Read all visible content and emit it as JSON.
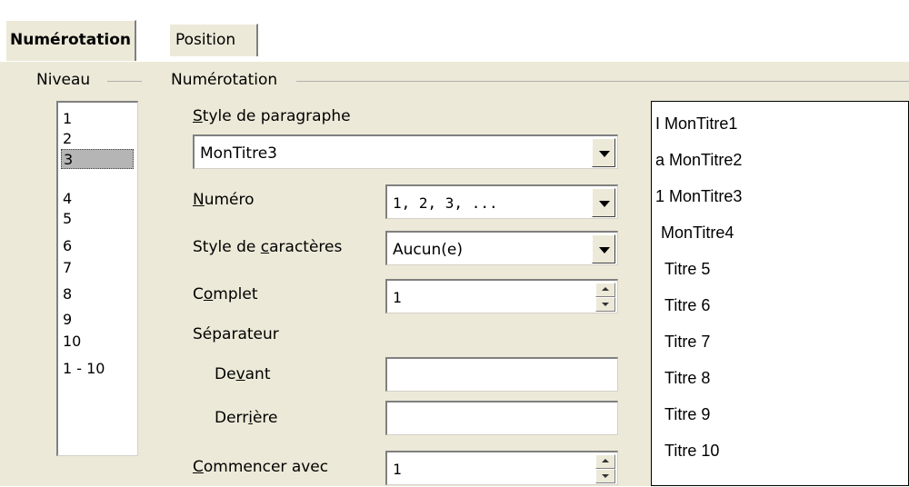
{
  "tabs": [
    {
      "label": "Numérotation"
    },
    {
      "label": "Position"
    }
  ],
  "level_group": {
    "title": "Niveau",
    "items": [
      "1",
      "2",
      "3",
      "4",
      "5",
      "6",
      "7",
      "8",
      "9",
      "10",
      "1 - 10"
    ],
    "selected": "3"
  },
  "numbering_group": {
    "title": "Numérotation",
    "paragraph_style": {
      "label": "Style de paragraphe",
      "value": "MonTitre3"
    },
    "number": {
      "label": "Numéro",
      "value": "1, 2, 3, ..."
    },
    "char_style": {
      "label": "Style de caractères",
      "value": "Aucun(e)"
    },
    "complete": {
      "label": "Complet",
      "value": "1"
    },
    "separator": {
      "label": "Séparateur"
    },
    "before": {
      "label": "Devant",
      "value": ""
    },
    "after": {
      "label": "Derrière",
      "value": ""
    },
    "start_with": {
      "label": "Commencer avec",
      "value": "1"
    }
  },
  "preview": {
    "lines": [
      "I MonTitre1",
      "a MonTitre2",
      "1 MonTitre3",
      "MonTitre4",
      "Titre 5",
      "Titre 6",
      "Titre 7",
      "Titre 8",
      "Titre 9",
      "Titre 10"
    ]
  }
}
